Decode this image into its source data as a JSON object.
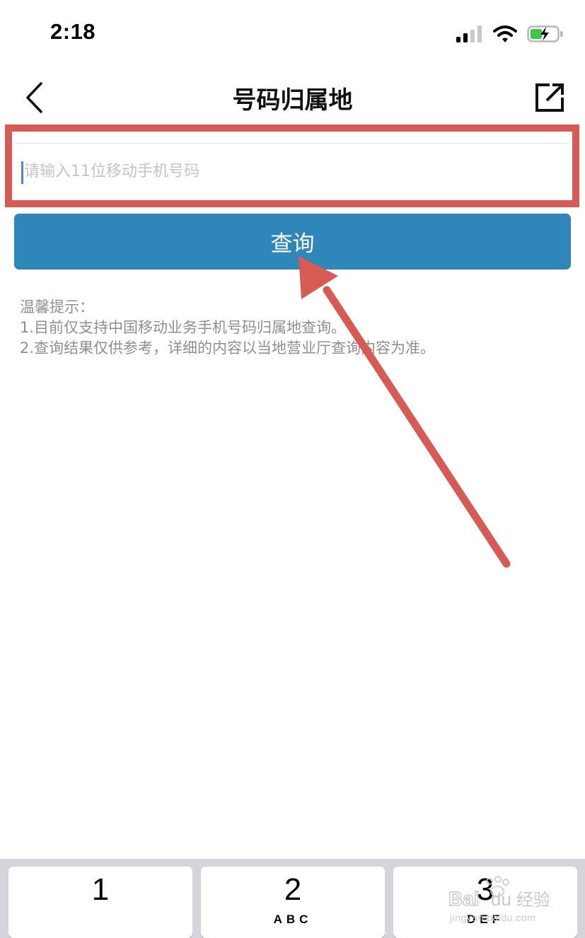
{
  "status_bar": {
    "time": "2:18",
    "icons": [
      "signal-icon",
      "wifi-icon",
      "battery-charging-icon"
    ]
  },
  "nav": {
    "title": "号码归属地",
    "back_icon": "chevron-left-icon",
    "share_icon": "share-external-icon"
  },
  "form": {
    "phone_placeholder": "请输入11位移动手机号码",
    "phone_value": "",
    "query_label": "查询"
  },
  "tips": {
    "heading": "温馨提示：",
    "items": [
      "1.目前仅支持中国移动业务手机号码归属地查询。",
      "2.查询结果仅供参考，详细的内容以当地营业厅查询内容为准。"
    ]
  },
  "keyboard": {
    "keys": [
      {
        "digit": "1",
        "letters": ""
      },
      {
        "digit": "2",
        "letters": "ABC"
      },
      {
        "digit": "3",
        "letters": "DEF"
      }
    ]
  },
  "watermark": {
    "brand": "Baidu经验",
    "url": "jingyan.baidu.com"
  },
  "colors": {
    "highlight": "#d85a55",
    "query_button": "#2f86b8",
    "tip_text": "#8f8f8f",
    "keyboard_bg": "#d3d5db"
  }
}
